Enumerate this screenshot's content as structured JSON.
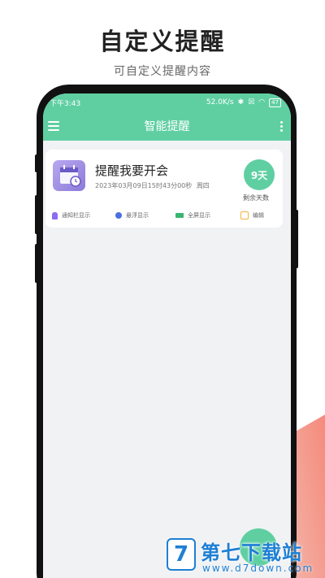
{
  "promo": {
    "title": "自定义提醒",
    "subtitle": "可自定义提醒内容"
  },
  "status_bar": {
    "time": "下午3:43",
    "network_speed": "52.0K/s",
    "battery": "47"
  },
  "app_bar": {
    "title": "智能提醒",
    "menu_icon": "menu-icon",
    "more_icon": "more-vertical-icon"
  },
  "reminder": {
    "title": "提醒我要开会",
    "datetime": "2023年03月09日15时43分00秒",
    "weekday": "周四",
    "days_left": "9天",
    "days_left_label": "剩余天数",
    "icon": "calendar-clock-icon"
  },
  "options": {
    "notification": "通知栏显示",
    "floating": "悬浮显示",
    "fullscreen": "全屏显示",
    "edit": "编辑"
  },
  "watermark": {
    "logo_glyph": "7",
    "name": "第七下载站",
    "url": "www.d7down.com"
  },
  "colors": {
    "accent": "#5fcfa2",
    "deco": "#f07b6e"
  }
}
